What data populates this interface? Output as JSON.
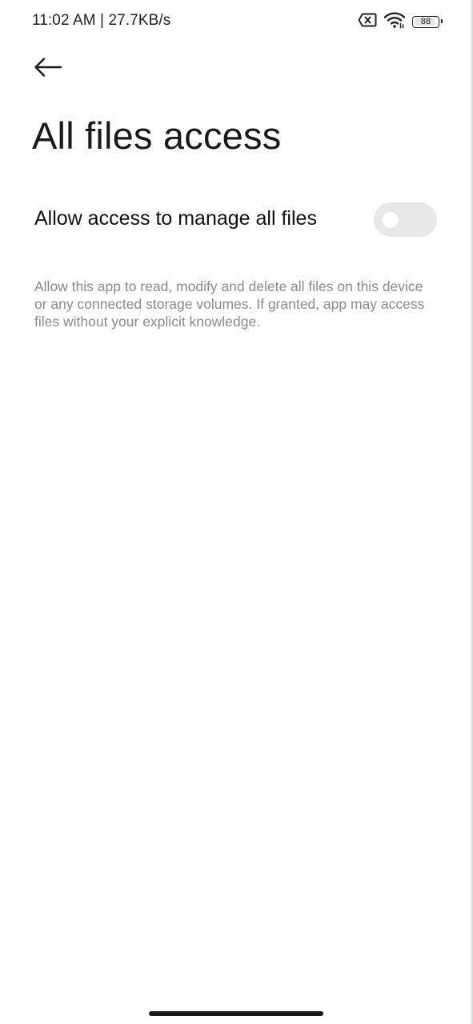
{
  "status_bar": {
    "time_and_speed": "11:02 AM | 27.7KB/s",
    "battery_level": "88",
    "battery_fraction": 0.88,
    "icons": [
      "sim-error-icon",
      "wifi-icon",
      "battery-icon"
    ]
  },
  "header": {
    "back_icon": "back-arrow-icon",
    "title": "All files access"
  },
  "setting": {
    "label": "Allow access to manage all files",
    "enabled": false
  },
  "description": "Allow this app to read, modify and delete all files on this device or any connected storage volumes. If granted, app may access files without your explicit knowledge.",
  "colors": {
    "background": "#ffffff",
    "title": "#1a1a1a",
    "description": "#8a8a8a",
    "toggle_off": "#e8e8e8"
  }
}
